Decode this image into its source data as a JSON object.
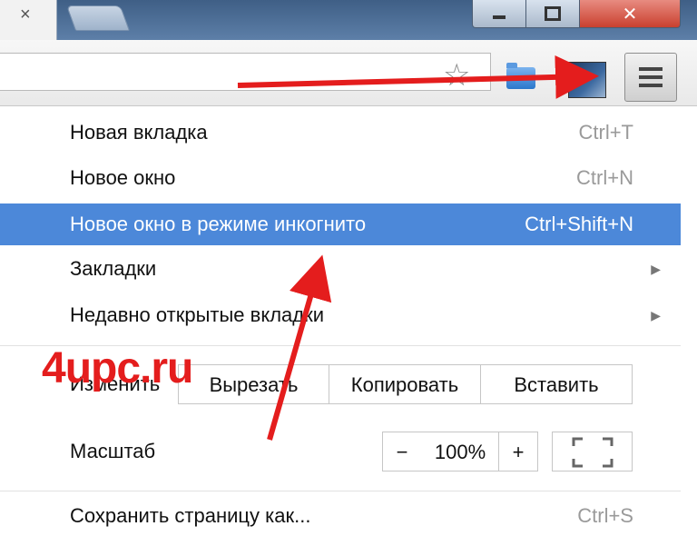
{
  "window": {
    "tab_close_glyph": "×",
    "close_glyph": "✕"
  },
  "menu": {
    "items": [
      {
        "label": "Новая вкладка",
        "shortcut": "Ctrl+T"
      },
      {
        "label": "Новое окно",
        "shortcut": "Ctrl+N"
      },
      {
        "label": "Новое окно в режиме инкогнито",
        "shortcut": "Ctrl+Shift+N",
        "highlighted": true
      },
      {
        "label": "Закладки",
        "shortcut": "",
        "submenu": true
      },
      {
        "label": "Недавно открытые вкладки",
        "shortcut": "",
        "submenu": true
      }
    ],
    "submenu_arrow": "▶",
    "edit": {
      "label": "Изменить",
      "cut": "Вырезать",
      "copy": "Копировать",
      "paste": "Вставить"
    },
    "zoom": {
      "label": "Масштаб",
      "minus": "−",
      "value": "100%",
      "plus": "+"
    },
    "save": {
      "label": "Сохранить страницу как...",
      "shortcut": "Ctrl+S"
    }
  },
  "watermark": "4upc.ru",
  "colors": {
    "highlight": "#4c88d9",
    "annotation_arrow": "#e41d1d"
  }
}
